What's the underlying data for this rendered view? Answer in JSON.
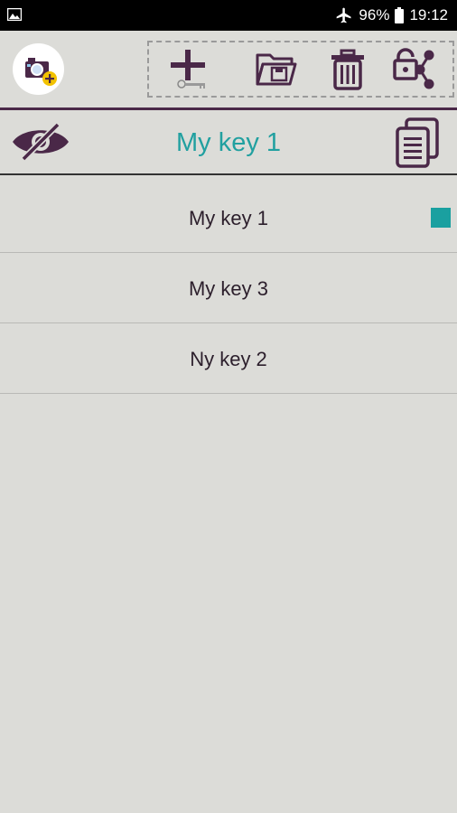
{
  "status_bar": {
    "battery": "96%",
    "time": "19:12",
    "icons": [
      "gallery-icon",
      "airplane-icon",
      "battery-icon"
    ]
  },
  "toolbar": {
    "icons": [
      "app-logo-icon",
      "add-key-icon",
      "open-folder-icon",
      "delete-icon",
      "share-lock-icon"
    ]
  },
  "header": {
    "title": "My key 1",
    "left_icon": "eye-hidden-icon",
    "right_icon": "copy-icon"
  },
  "keys": [
    {
      "label": "My key 1",
      "selected": true
    },
    {
      "label": "My key 3",
      "selected": false
    },
    {
      "label": "Ny key 2",
      "selected": false
    }
  ],
  "colors": {
    "accent": "#21a0a0",
    "brand": "#4a2848",
    "background": "#dcdcd8"
  }
}
